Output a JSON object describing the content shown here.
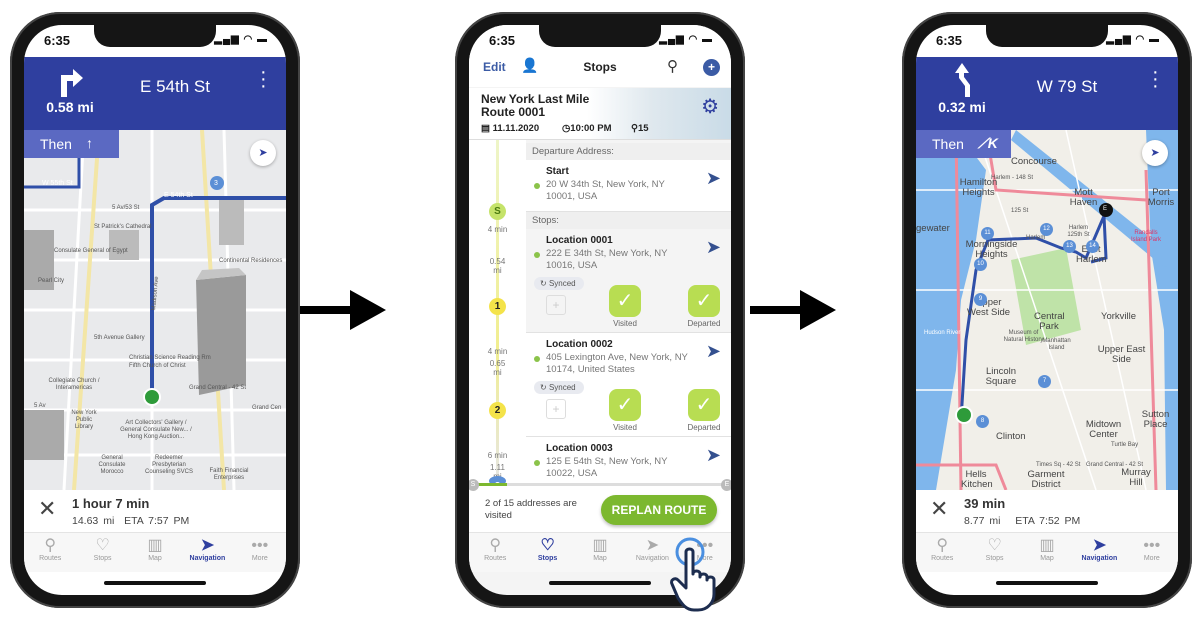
{
  "status_time": "6:35",
  "colors": {
    "nav_blue": "#2f3f9f",
    "then_blue": "#5b69c2",
    "accent_green": "#7cb82f",
    "check_green": "#b8dd52",
    "stop_yellow": "#f4e34a"
  },
  "tabs": [
    {
      "label": "Routes",
      "icon": "routes-icon"
    },
    {
      "label": "Stops",
      "icon": "stops-icon"
    },
    {
      "label": "Map",
      "icon": "map-icon"
    },
    {
      "label": "Navigation",
      "icon": "navigation-icon"
    },
    {
      "label": "More",
      "icon": "more-icon"
    }
  ],
  "left": {
    "distance": "0.58 mi",
    "street": "E 54th St",
    "then": "Then",
    "turn_icon": "turn-right-icon",
    "then_icon": "straight-arrow-icon",
    "duration": "1 hour 7 min",
    "trip_distance": "14.63 mi",
    "eta": "ETA 7:57 PM",
    "active_tab": "Navigation",
    "map_labels": [
      "W 55th St",
      "E 54th St",
      "5 Av/53 St",
      "St Patrick's Cathedral",
      "Consulate General of Egypt",
      "Continental Residences",
      "Pearl City",
      "Madison Ave",
      "5th Avenue Gallery",
      "Christian Science Reading Rm",
      "Fifth Church of Christ",
      "Collegiate Church / Interamericas",
      "Grand Central - 42 St",
      "5 Av",
      "New York Public Library",
      "Art Collectors' Gallery / General Consulate New... / Hong Kong Auction...",
      "General Consulate Morocco",
      "Redeemer Presbyterian Counseling SVCS",
      "Faith Financial Enterprises",
      "Grand Cen"
    ],
    "stop_marker": "3"
  },
  "middle": {
    "edit": "Edit",
    "title": "Stops",
    "route_name": "New York Last Mile Route 0001",
    "date": "11.11.2020",
    "time": "10:00 PM",
    "stop_count": "15",
    "departure_label": "Departure Address:",
    "stops_label": "Stops:",
    "start": {
      "name": "Start",
      "address": "20 W 34th St, New York, NY 10001, USA",
      "badge": "S",
      "time": "4 min"
    },
    "stops": [
      {
        "name": "Location 0001",
        "address": "222 E 34th St, New York, NY 10016, USA",
        "sync": "Synced",
        "visited": "Visited",
        "departed": "Departed",
        "badge": "1",
        "distance": "0.54 mi",
        "time": "4 min"
      },
      {
        "name": "Location 0002",
        "address": "405 Lexington Ave, New York, NY 10174, United States",
        "sync": "Synced",
        "visited": "Visited",
        "departed": "Departed",
        "badge": "2",
        "distance": "0.65 mi",
        "time": "6 min"
      },
      {
        "name": "Location 0003",
        "address": "125 E 54th St, New York, NY 10022, USA",
        "badge": "3",
        "distance": "1.11 mi"
      }
    ],
    "progress_text": "2 of 15 addresses are visited",
    "visited_count": 2,
    "total_count": 15,
    "replan": "REPLAN ROUTE",
    "scroll_start": "S",
    "scroll_end": "E",
    "active_tab": "Stops"
  },
  "right": {
    "distance": "0.32 mi",
    "street": "W 79 St",
    "then": "Then",
    "turn_icon": "slight-left-icon",
    "then_icon": "keep-left-icon",
    "duration": "39 min",
    "trip_distance": "8.77 mi",
    "eta": "ETA 7:52 PM",
    "active_tab": "Navigation",
    "map_labels": [
      "Concourse",
      "Hamilton Heights",
      "gewater",
      "Mott Haven",
      "Port Morris",
      "Morningside Heights",
      "Harlem",
      "East Harlem",
      "Randalls Island Park",
      "Upper West Side",
      "Central Park",
      "Yorkville",
      "Hudson River",
      "Museum of Natural History",
      "Manhattan Island",
      "Upper East Side",
      "Lincoln Square",
      "Midtown Center",
      "Sutton Place",
      "Clinton",
      "Turtle Bay",
      "Times Sq - 42 St",
      "Grand Central - 42 St",
      "Murray Hill",
      "Hells Kitchen",
      "Garment District",
      "Harlem - 148 St",
      "125 St",
      "Harlem 125th St"
    ],
    "markers": [
      "E",
      "12",
      "11",
      "13",
      "14",
      "10",
      "9",
      "7",
      "8"
    ]
  }
}
